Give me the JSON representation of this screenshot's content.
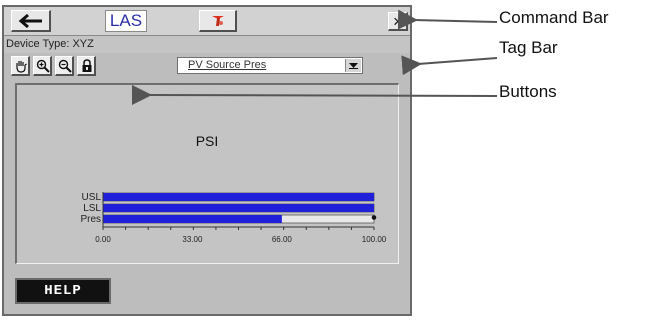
{
  "command_bar": {
    "back_icon": "left-arrow-icon",
    "app_label": "LAS",
    "fault_icon": "fault-indicator-icon",
    "close_label": "×"
  },
  "tag_bar": {
    "device_type": "Device Type: XYZ"
  },
  "toolbar": {
    "tools": [
      "hand-pan-icon",
      "zoom-in-icon",
      "zoom-out-icon",
      "lock-icon"
    ],
    "dropdown_value": "PV Source Pres"
  },
  "chart_data": {
    "type": "bar",
    "orientation": "horizontal",
    "title": "PSI",
    "categories": [
      "USL",
      "LSL",
      "Pres"
    ],
    "values": [
      100,
      100,
      66
    ],
    "xlim": [
      0,
      100
    ],
    "ticks": [
      "0.00",
      "33.00",
      "66.00",
      "100.00"
    ],
    "bar_color": "#2020d8"
  },
  "help_button": {
    "label": "HELP"
  },
  "callouts": {
    "command_bar": "Command Bar",
    "tag_bar": "Tag Bar",
    "buttons": "Buttons"
  }
}
